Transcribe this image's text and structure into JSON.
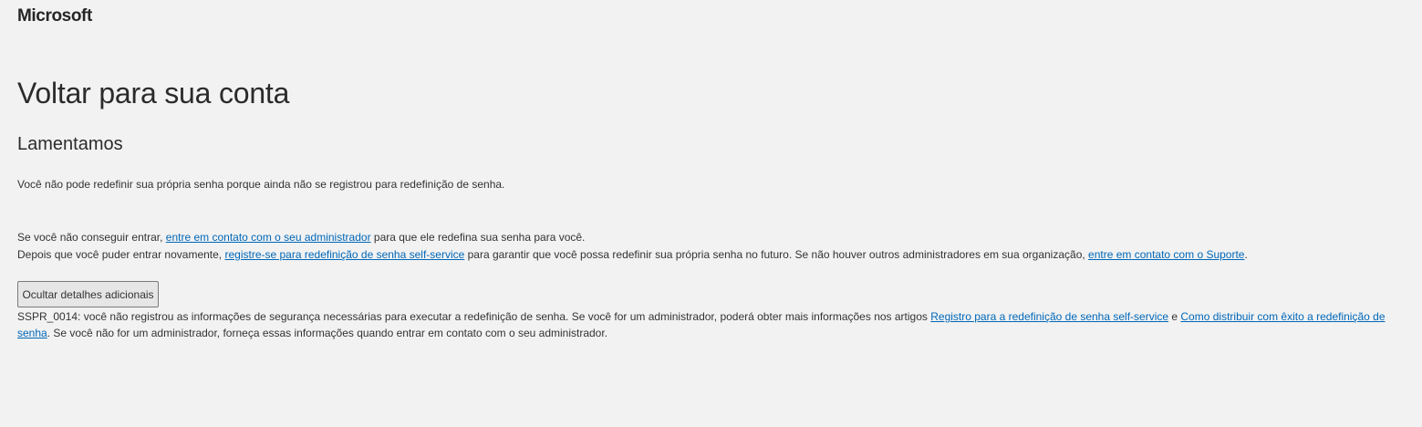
{
  "header": {
    "logo_text": "Microsoft"
  },
  "main": {
    "title": "Voltar para sua conta",
    "subtitle": "Lamentamos",
    "message": "Você não pode redefinir sua própria senha porque ainda não se registrou para redefinição de senha.",
    "contact_line": {
      "prefix": "Se você não conseguir entrar, ",
      "link": "entre em contato com o seu administrador",
      "suffix": " para que ele redefina sua senha para você."
    },
    "register_line": {
      "prefix": "Depois que você puder entrar novamente, ",
      "link1": "registre-se para redefinição de senha self-service",
      "middle": " para garantir que você possa redefinir sua própria senha no futuro. Se não houver outros administradores em sua organização, ",
      "link2": "entre em contato com o Suporte",
      "suffix": "."
    },
    "details_button_label": "Ocultar detalhes adicionais",
    "details": {
      "prefix": "SSPR_0014: você não registrou as informações de segurança necessárias para executar a redefinição de senha. Se você for um administrador, poderá obter mais informações nos artigos ",
      "link1": "Registro para a redefinição de senha self-service",
      "middle": " e ",
      "link2": "Como distribuir com êxito a redefinição de senha",
      "suffix": ". Se você não for um administrador, forneça essas informações quando entrar em contato com o seu administrador."
    }
  },
  "colors": {
    "background": "#f2f2f2",
    "link": "#0067b8",
    "text": "#333333"
  }
}
